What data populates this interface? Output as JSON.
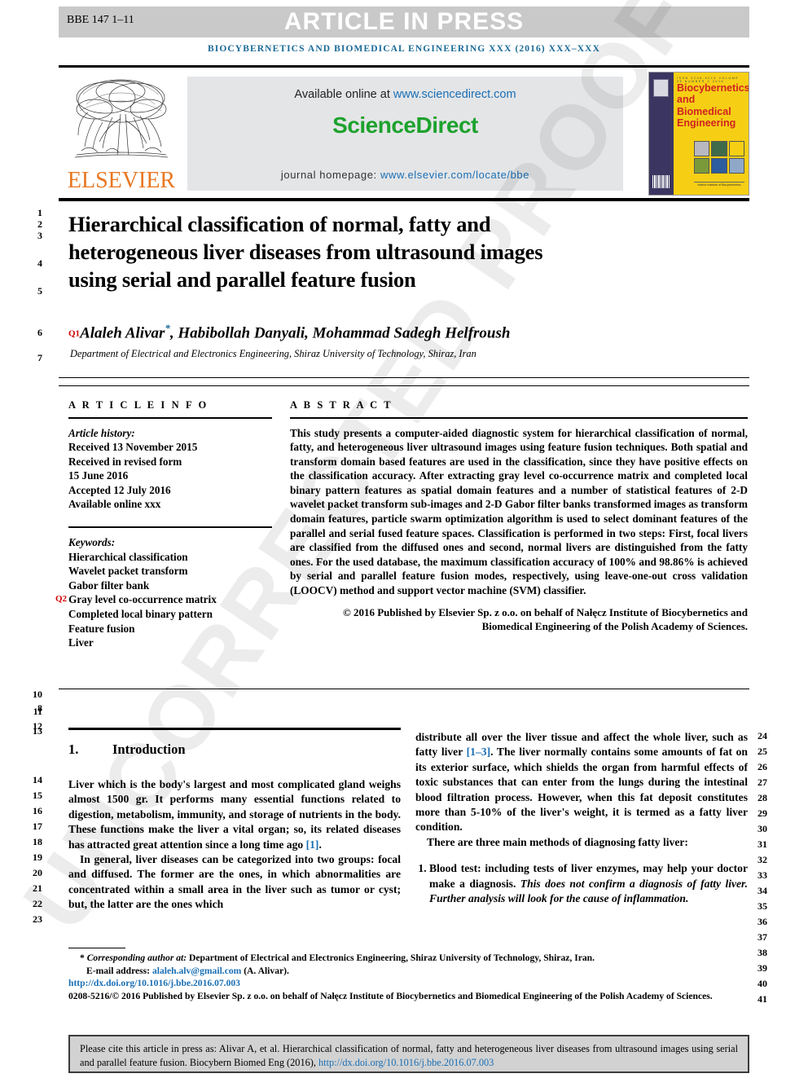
{
  "header": {
    "article_id": "BBE 147 1–11",
    "status_banner": "ARTICLE IN PRESS",
    "journal_running_head": "BIOCYBERNETICS AND BIOMEDICAL ENGINEERING XXX (2016) XXX–XXX"
  },
  "masthead": {
    "publisher_name": "ELSEVIER",
    "available_text": "Available online at",
    "available_url": "www.sciencedirect.com",
    "sciencedirect_logo": "ScienceDirect",
    "homepage_label": "journal homepage:",
    "homepage_url": "www.elsevier.com/locate/bbe",
    "cover": {
      "issn_line": "ISSN 0208-5216   VOLUME 36   NUMBER 2   2016",
      "title_line1": "Biocybernetics",
      "title_line2": "and Biomedical",
      "title_line3": "Engineering",
      "footer_text": "Nalecz Institute of Biocybernetics"
    }
  },
  "watermark": "UNCORRECTED PROOF",
  "title": "Hierarchical classification of normal, fatty and heterogeneous liver diseases from ultrasound images using serial and parallel feature fusion",
  "query_tags": {
    "q1": "Q1",
    "q2": "Q2"
  },
  "authors": "Alaleh Alivar",
  "authors_rest": ", Habibollah Danyali, Mohammad Sadegh Helfroush",
  "affiliation": "Department of Electrical and Electronics Engineering, Shiraz University of Technology, Shiraz, Iran",
  "article_info": {
    "heading": "A R T I C L E   I N F O",
    "history_label": "Article history:",
    "history": [
      "Received 13 November 2015",
      "Received in revised form",
      "15 June 2016",
      "Accepted 12 July 2016",
      "Available online xxx"
    ],
    "keywords_label": "Keywords:",
    "keywords": [
      "Hierarchical classification",
      "Wavelet packet transform",
      "Gabor filter bank",
      "Gray level co-occurrence matrix",
      "Completed local binary pattern",
      "Feature fusion",
      "Liver"
    ]
  },
  "abstract": {
    "heading": "A B S T R A C T",
    "body": "This study presents a computer-aided diagnostic system for hierarchical classification of normal, fatty, and heterogeneous liver ultrasound images using feature fusion techniques. Both spatial and transform domain based features are used in the classification, since they have positive effects on the classification accuracy. After extracting gray level co-occurrence matrix and completed local binary pattern features as spatial domain features and a number of statistical features of 2-D wavelet packet transform sub-images and 2-D Gabor filter banks transformed images as transform domain features, particle swarm optimization algorithm is used to select dominant features of the parallel and serial fused feature spaces. Classification is performed in two steps: First, focal livers are classified from the diffused ones and second, normal livers are distinguished from the fatty ones. For the used database, the maximum classification accuracy of 100% and 98.86% is achieved by serial and parallel feature fusion modes, respectively, using leave-one-out cross validation (LOOCV) method and support vector machine (SVM) classifier.",
    "copyright": "© 2016 Published by Elsevier Sp. z o.o. on behalf of Nałęcz Institute of Biocybernetics and Biomedical Engineering of the Polish Academy of Sciences."
  },
  "section": {
    "number": "1.",
    "heading": "Introduction"
  },
  "body_left": {
    "p1_a": "Liver which is the body's largest and most complicated gland weighs almost 1500 gr. It performs many essential functions related to digestion, metabolism, immunity, and storage of nutrients in the body. These functions make the liver a vital organ; so, its related diseases has attracted great attention since a long time ago ",
    "p1_ref": "[1]",
    "p1_b": ".",
    "p2": "In general, liver diseases can be categorized into two groups: focal and diffused. The former are the ones, in which abnormalities are concentrated within a small area in the liver such as tumor or cyst; but, the latter are the ones which"
  },
  "body_right": {
    "p1_a": "distribute all over the liver tissue and affect the whole liver, such as fatty liver ",
    "p1_ref": "[1–3]",
    "p1_b": ". The liver normally contains some amounts of fat on its exterior surface, which shields the organ from harmful effects of toxic substances that can enter from the lungs during the intestinal blood filtration process. However, when this fat deposit constitutes more than 5-10% of the liver's weight, it is termed as a fatty liver condition.",
    "p2": "There are three main methods of diagnosing fatty liver:",
    "list_item_1_plain": "Blood test: including tests of liver enzymes, may help your doctor make a diagnosis. ",
    "list_item_1_italic": "This does not confirm a diagnosis of fatty liver. Further analysis will look for the cause of inflammation."
  },
  "footnote": {
    "star": "*",
    "corresponding_label": "Corresponding author at:",
    "corresponding_text": " Department of Electrical and Electronics Engineering, Shiraz University of Technology, Shiraz, Iran.",
    "email_label": "E-mail address:",
    "email": "alaleh.alv@gmail.com",
    "email_suffix": " (A. Alivar).",
    "doi": "http://dx.doi.org/10.1016/j.bbe.2016.07.003",
    "issn_copyright": "0208-5216/© 2016 Published by Elsevier Sp. z o.o. on behalf of Nałęcz Institute of Biocybernetics and Biomedical Engineering of the Polish Academy of Sciences."
  },
  "cite_box": {
    "text": "Please cite this article in press as: Alivar A, et al. Hierarchical classification of normal, fatty and heterogeneous liver diseases from ultrasound images using serial and parallel feature fusion. Biocybern Biomed Eng (2016), ",
    "link": "http://dx.doi.org/10.1016/j.bbe.2016.07.003"
  },
  "line_numbers": {
    "left": [
      "1",
      "2",
      "3",
      "4",
      "5",
      "6",
      "7",
      "10",
      "11",
      "8",
      "12",
      "13",
      "14",
      "15",
      "16",
      "17",
      "18",
      "19",
      "20",
      "21",
      "22",
      "23"
    ],
    "right": [
      "24",
      "25",
      "26",
      "27",
      "28",
      "29",
      "30",
      "31",
      "32",
      "33",
      "34",
      "35",
      "36",
      "37",
      "38",
      "39",
      "40",
      "41"
    ]
  }
}
